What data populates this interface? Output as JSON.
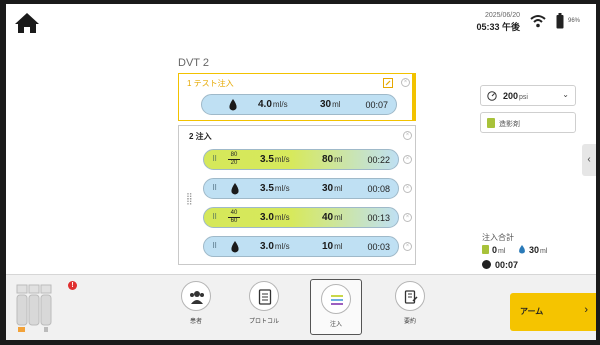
{
  "status": {
    "date": "2025/06/20",
    "time": "05:33 午後",
    "battery_percent": "96%"
  },
  "protocol_title": "DVT 2",
  "groups": [
    {
      "label": "1 テスト注入",
      "steps": [
        {
          "type": "single",
          "rate": "4.0",
          "rate_unit": "ml/s",
          "volume": "30",
          "volume_unit": "ml",
          "duration": "00:07"
        }
      ]
    },
    {
      "label": "2 注入",
      "steps": [
        {
          "type": "mix",
          "ratio_top": "80",
          "ratio_bottom": "20",
          "rate": "3.5",
          "rate_unit": "ml/s",
          "volume": "80",
          "volume_unit": "ml",
          "duration": "00:22"
        },
        {
          "type": "single",
          "rate": "3.5",
          "rate_unit": "ml/s",
          "volume": "30",
          "volume_unit": "ml",
          "duration": "00:08"
        },
        {
          "type": "mix",
          "ratio_top": "40",
          "ratio_bottom": "60",
          "rate": "3.0",
          "rate_unit": "ml/s",
          "volume": "40",
          "volume_unit": "ml",
          "duration": "00:13"
        },
        {
          "type": "single",
          "rate": "3.0",
          "rate_unit": "ml/s",
          "volume": "10",
          "volume_unit": "ml",
          "duration": "00:03"
        }
      ]
    }
  ],
  "pressure": {
    "value": "200",
    "unit": "psi"
  },
  "contrast_label": "造影剤",
  "totals": {
    "label": "注入合計",
    "contrast_volume": "0",
    "saline_volume": "30",
    "unit": "ml",
    "duration": "00:07"
  },
  "nav": {
    "patient": "患者",
    "protocol": "プロトコル",
    "inject": "注入",
    "summary": "要約"
  },
  "alert_mark": "!",
  "arm_button": "アーム",
  "colors": {
    "accent_yellow": "#f5c400",
    "saline_blue": "#bfe0f3",
    "contrast_green": "#d5e85a"
  }
}
